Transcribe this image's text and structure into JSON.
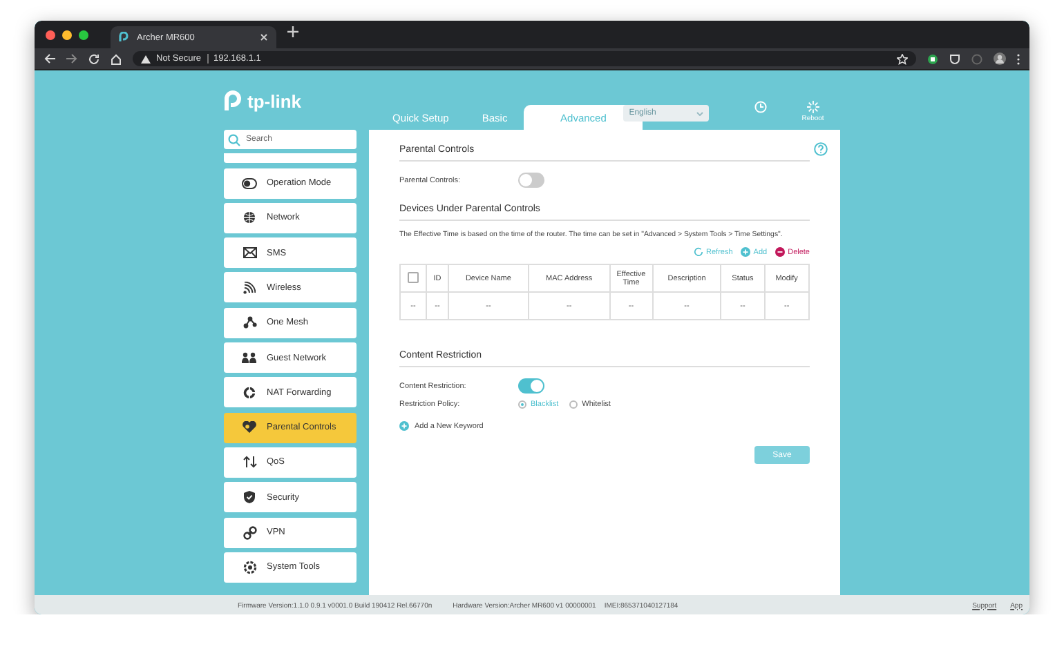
{
  "browser": {
    "tab_title": "Archer MR600",
    "security": "Not Secure",
    "url": "192.168.1.1"
  },
  "header": {
    "logo": "tp-link",
    "tabs": [
      {
        "label": "Quick Setup",
        "selected": false
      },
      {
        "label": "Basic",
        "selected": false
      },
      {
        "label": "Advanced",
        "selected": true
      }
    ],
    "language": "English",
    "reboot": "Reboot"
  },
  "sidebar": {
    "search_placeholder": "Search",
    "items": [
      {
        "label": "Operation Mode",
        "selected": false
      },
      {
        "label": "Network",
        "selected": false
      },
      {
        "label": "SMS",
        "selected": false
      },
      {
        "label": "Wireless",
        "selected": false
      },
      {
        "label": "One Mesh",
        "selected": false
      },
      {
        "label": "Guest Network",
        "selected": false
      },
      {
        "label": "NAT Forwarding",
        "selected": false
      },
      {
        "label": "Parental Controls",
        "selected": true
      },
      {
        "label": "QoS",
        "selected": false
      },
      {
        "label": "Security",
        "selected": false
      },
      {
        "label": "VPN",
        "selected": false
      },
      {
        "label": "System Tools",
        "selected": false
      }
    ]
  },
  "parental_controls": {
    "title": "Parental Controls",
    "toggle_label": "Parental Controls:",
    "on": false
  },
  "devices": {
    "title": "Devices Under Parental Controls",
    "note": "The Effective Time is based on the time of the router. The time can be set in \"Advanced > System Tools > Time Settings\".",
    "actions": [
      {
        "kind": "refresh",
        "label": "Refresh"
      },
      {
        "kind": "add",
        "label": "Add"
      },
      {
        "kind": "delete",
        "label": "Delete"
      }
    ],
    "header_checked": false,
    "columns": [
      "",
      "ID",
      "Device Name",
      "MAC Address",
      "Effective Time",
      "Description",
      "Status",
      "Modify"
    ],
    "rows": [
      [
        "--",
        "--",
        "--",
        "--",
        "--",
        "--",
        "--",
        "--"
      ]
    ]
  },
  "content_restriction": {
    "title": "Content Restriction",
    "toggle_label": "Content Restriction:",
    "on": true,
    "policy_label": "Restriction Policy:",
    "options": [
      {
        "label": "Blacklist",
        "selected": true
      },
      {
        "label": "Whitelist",
        "selected": false
      }
    ],
    "add_keyword": "Add a New Keyword",
    "save": "Save"
  },
  "footer": {
    "firmware": "Firmware Version:1.1.0 0.9.1 v0001.0 Build 190412 Rel.66770n",
    "hardware": "Hardware Version:Archer MR600 v1 00000001",
    "imei": "IMEI:865371040127184",
    "links": [
      "Support",
      "App"
    ]
  }
}
